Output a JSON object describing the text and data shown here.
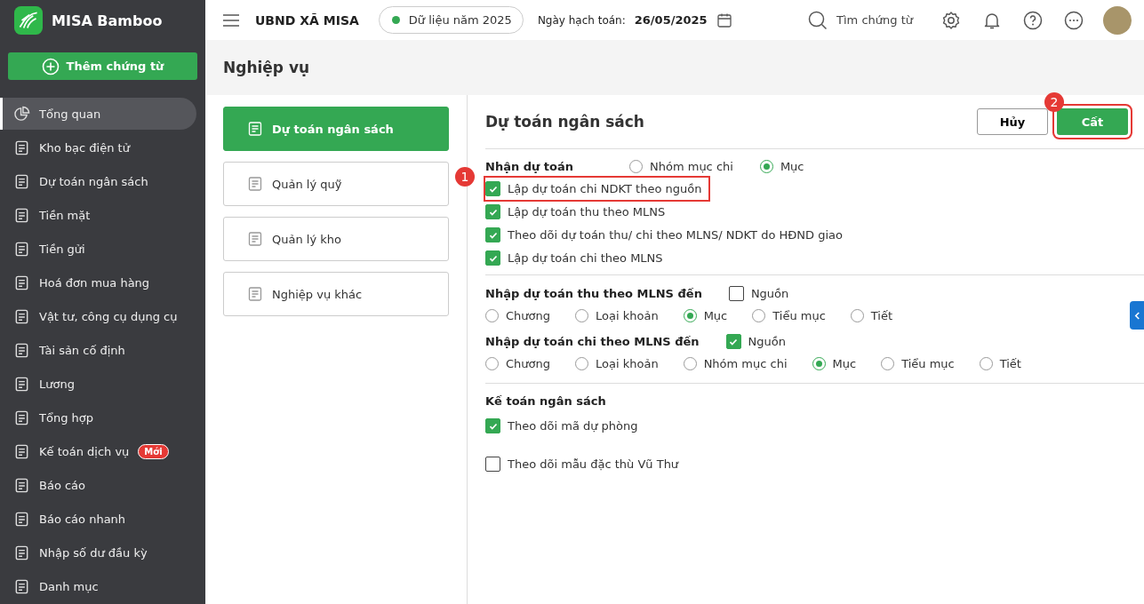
{
  "app": {
    "name": "MISA Bamboo",
    "add_button": "Thêm chứng từ"
  },
  "sidebar": {
    "items": [
      {
        "label": "Tổng quan",
        "selected": true
      },
      {
        "label": "Kho bạc điện tử",
        "selected": false
      },
      {
        "label": "Dự toán ngân sách",
        "selected": false
      },
      {
        "label": "Tiền mặt",
        "selected": false
      },
      {
        "label": "Tiền gửi",
        "selected": false
      },
      {
        "label": "Hoá đơn mua hàng",
        "selected": false
      },
      {
        "label": "Vật tư, công cụ dụng cụ",
        "selected": false
      },
      {
        "label": "Tài sản cố định",
        "selected": false
      },
      {
        "label": "Lương",
        "selected": false
      },
      {
        "label": "Tổng hợp",
        "selected": false
      },
      {
        "label": "Kế toán dịch vụ",
        "selected": false,
        "badge": "Mới"
      },
      {
        "label": "Báo cáo",
        "selected": false
      },
      {
        "label": "Báo cáo nhanh",
        "selected": false
      },
      {
        "label": "Nhập số dư đầu kỳ",
        "selected": false
      },
      {
        "label": "Danh mục",
        "selected": false
      }
    ]
  },
  "topbar": {
    "org": "UBND XÃ MISA",
    "data_year": "Dữ liệu năm 2025",
    "date_label": "Ngày hạch toán:",
    "date": "26/05/2025",
    "search_placeholder": "Tìm chứng từ"
  },
  "page_title": "Nghiệp vụ",
  "categories": [
    {
      "label": "Dự toán ngân sách",
      "selected": true
    },
    {
      "label": "Quản lý quỹ",
      "selected": false
    },
    {
      "label": "Quản lý kho",
      "selected": false
    },
    {
      "label": "Nghiệp vụ khác",
      "selected": false
    }
  ],
  "settings": {
    "title": "Dự toán ngân sách",
    "cancel": "Hủy",
    "save": {
      "label": "Cất",
      "callout": "2"
    },
    "receive": {
      "label": "Nhận dự toán",
      "options": [
        {
          "label": "Nhóm mục chi",
          "selected": false
        },
        {
          "label": "Mục",
          "selected": true
        }
      ]
    },
    "checks": [
      {
        "label": "Lập dự toán chi NDKT theo nguồn",
        "checked": true,
        "callout": "1"
      },
      {
        "label": "Lập dự toán thu theo MLNS",
        "checked": true
      },
      {
        "label": "Theo dõi dự toán thu/ chi theo MLNS/ NDKT do HĐND giao",
        "checked": true
      },
      {
        "label": "Lập dự toán chi theo MLNS",
        "checked": true
      }
    ],
    "levels": [
      {
        "label": "Nhập dự toán thu theo MLNS đến",
        "source": {
          "label": "Nguồn",
          "checked": false
        },
        "options": [
          {
            "label": "Chương",
            "selected": false
          },
          {
            "label": "Loại khoản",
            "selected": false
          },
          {
            "label": "Mục",
            "selected": true
          },
          {
            "label": "Tiểu mục",
            "selected": false
          },
          {
            "label": "Tiết",
            "selected": false
          }
        ]
      },
      {
        "label": "Nhập dự toán chi theo MLNS đến",
        "source": {
          "label": "Nguồn",
          "checked": true
        },
        "options": [
          {
            "label": "Chương",
            "selected": false
          },
          {
            "label": "Loại khoản",
            "selected": false
          },
          {
            "label": "Nhóm mục chi",
            "selected": false
          },
          {
            "label": "Mục",
            "selected": true
          },
          {
            "label": "Tiểu mục",
            "selected": false
          },
          {
            "label": "Tiết",
            "selected": false
          }
        ]
      }
    ],
    "accounting": {
      "label": "Kế toán ngân sách",
      "checks": [
        {
          "label": "Theo dõi mã dự phòng",
          "checked": true
        }
      ]
    },
    "extra": {
      "label": "Theo dõi mẫu đặc thù Vũ Thư",
      "checked": false
    }
  }
}
